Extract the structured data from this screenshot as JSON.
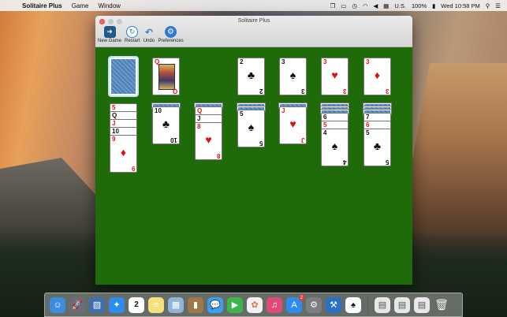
{
  "menubar": {
    "app_name": "Solitaire Plus",
    "items": [
      "Game",
      "Window"
    ],
    "input_source": "U.S.",
    "battery": "100%",
    "clock": "Wed 10:58 PM"
  },
  "window": {
    "title": "Solitaire Plus",
    "toolbar": [
      {
        "label": "New Game",
        "icon": "new-game-icon"
      },
      {
        "label": "Restart",
        "icon": "restart-icon"
      },
      {
        "label": "Undo",
        "icon": "undo-icon"
      },
      {
        "label": "Preferences",
        "icon": "gear-icon"
      }
    ]
  },
  "game": {
    "stock": {
      "face_down": true
    },
    "waste": {
      "rank": "Q",
      "suit": "♥"
    },
    "foundations": [
      {
        "rank": "2",
        "suit": "♣"
      },
      {
        "rank": "3",
        "suit": "♠"
      },
      {
        "rank": "3",
        "suit": "♥"
      },
      {
        "rank": "3",
        "suit": "♦"
      }
    ],
    "tableau": [
      {
        "hidden": 0,
        "cards": [
          [
            "5",
            "♥"
          ],
          [
            "Q",
            "♠"
          ],
          [
            "J",
            "♥"
          ],
          [
            "10",
            "♠"
          ],
          [
            "9",
            "♦"
          ]
        ]
      },
      {
        "hidden": 1,
        "cards": [
          [
            "10",
            "♣"
          ]
        ]
      },
      {
        "hidden": 1,
        "cards": [
          [
            "Q",
            "♥"
          ],
          [
            "J",
            "♣"
          ],
          [
            "8",
            "♥"
          ]
        ]
      },
      {
        "hidden": 2,
        "cards": [
          [
            "5",
            "♠"
          ]
        ]
      },
      {
        "hidden": 1,
        "cards": [
          [
            "J",
            "♥"
          ]
        ]
      },
      {
        "hidden": 3,
        "cards": [
          [
            "6",
            "♠"
          ],
          [
            "5",
            "♥"
          ],
          [
            "4",
            "♠"
          ]
        ]
      },
      {
        "hidden": 3,
        "cards": [
          [
            "7",
            "♠"
          ],
          [
            "6",
            "♥"
          ],
          [
            "5",
            "♣"
          ]
        ]
      }
    ]
  },
  "dock": {
    "apps": [
      "finder-icon",
      "launchpad-icon",
      "preview-icon",
      "safari-icon",
      "calendar-icon",
      "notes-icon",
      "photo-icon",
      "contacts-icon",
      "messages-icon",
      "facetime-icon",
      "photos-icon",
      "itunes-icon",
      "app-store-icon",
      "system-preferences-icon",
      "xcode-icon",
      "solitaire-icon"
    ],
    "calendar_date": "2",
    "app_store_badge": "2"
  }
}
